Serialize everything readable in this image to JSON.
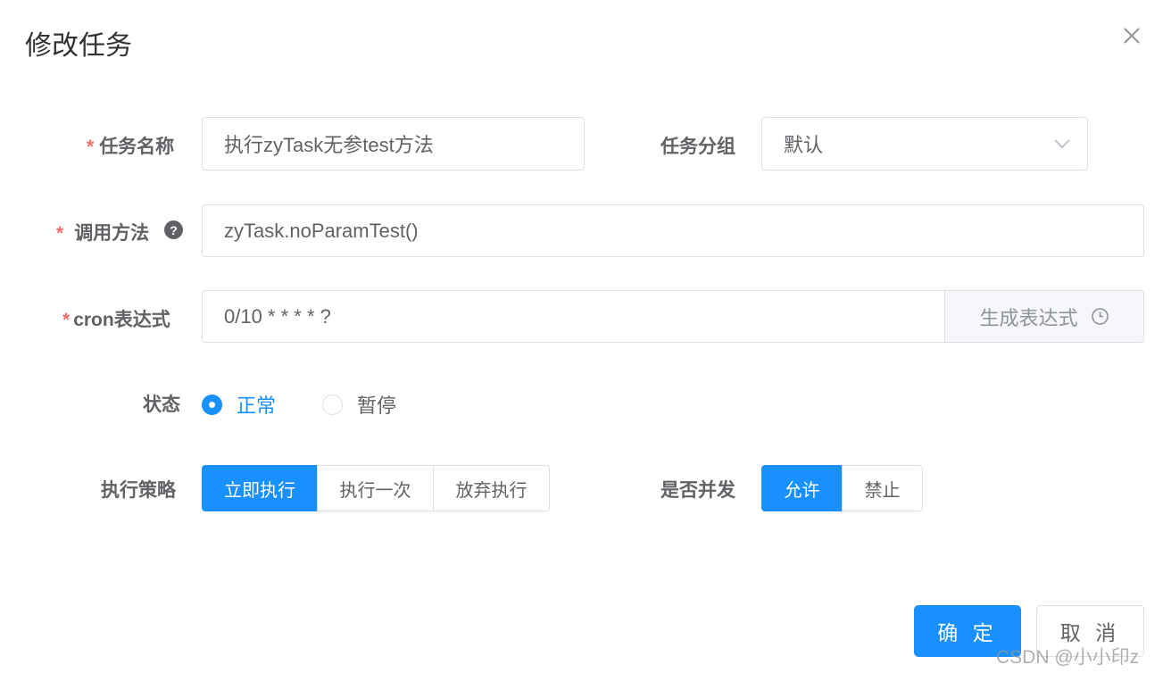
{
  "dialog": {
    "title": "修改任务"
  },
  "form": {
    "job_name": {
      "label": "任务名称",
      "value": "执行zyTask无参test方法"
    },
    "job_group": {
      "label": "任务分组",
      "value": "默认"
    },
    "invoke_target": {
      "label": "调用方法",
      "value": "zyTask.noParamTest()",
      "help": "?"
    },
    "cron": {
      "label": "cron表达式",
      "value": "0/10 * * * * ?",
      "generate_label": "生成表达式"
    },
    "status": {
      "label": "状态",
      "options": [
        "正常",
        "暂停"
      ],
      "selected": "正常"
    },
    "misfire_policy": {
      "label": "执行策略",
      "options": [
        "立即执行",
        "执行一次",
        "放弃执行"
      ],
      "selected": "立即执行"
    },
    "concurrent": {
      "label": "是否并发",
      "options": [
        "允许",
        "禁止"
      ],
      "selected": "允许"
    },
    "required_mark": "*"
  },
  "footer": {
    "confirm_label": "确 定",
    "cancel_label": "取 消"
  },
  "watermark": "CSDN @小小印z",
  "colors": {
    "primary": "#1890ff",
    "required": "#f56c6c",
    "text": "#606266",
    "border": "#dcdfe6"
  },
  "icons": {
    "close": "close-icon",
    "select": "chevron-down-icon",
    "clock": "clock-icon",
    "help": "question-circle-icon"
  }
}
